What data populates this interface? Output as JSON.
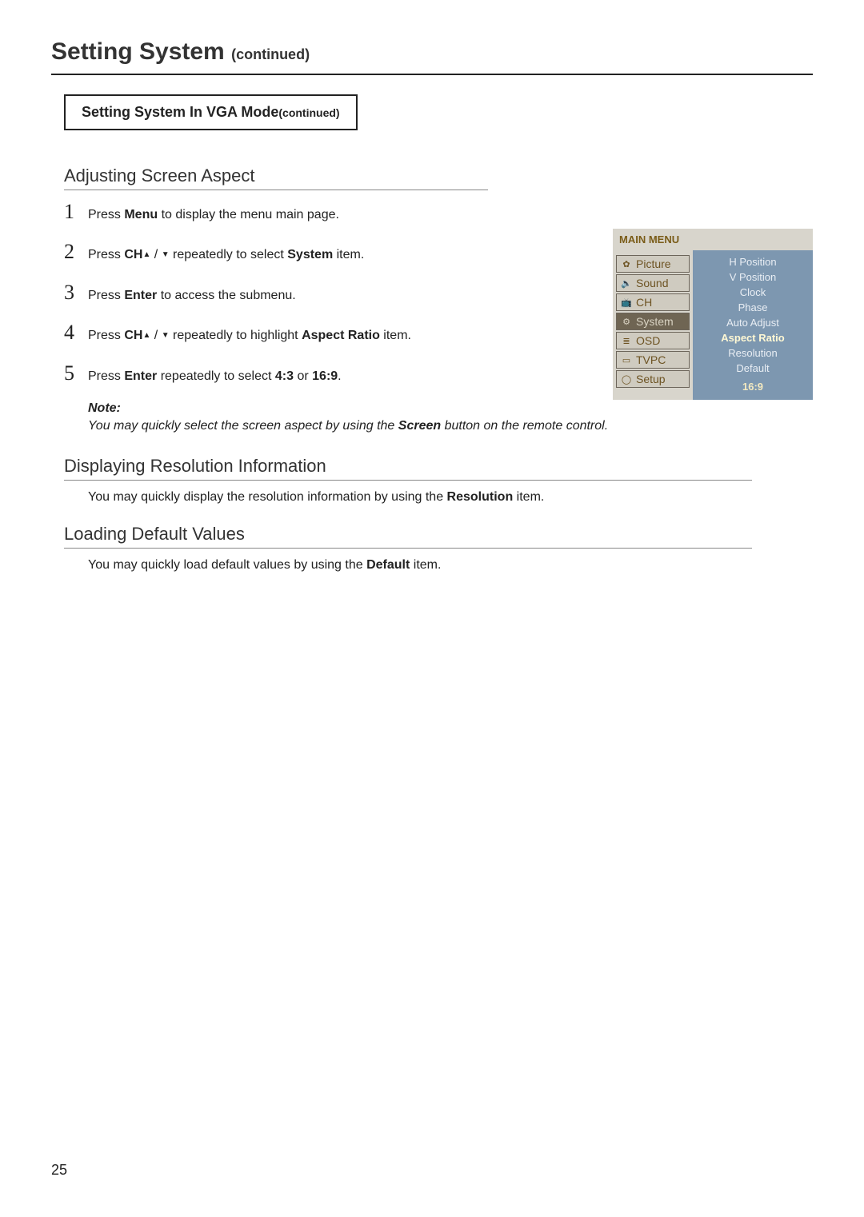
{
  "header": {
    "title": "Setting System",
    "continued": "(continued)"
  },
  "boxTitle": {
    "main": "Setting System In VGA Mode",
    "cont": "(continued)"
  },
  "sections": {
    "aspect": {
      "heading": "Adjusting Screen Aspect",
      "steps": {
        "s1": {
          "num": "1",
          "pre": "Press  ",
          "b1": "Menu",
          "post": " to display the menu main page."
        },
        "s2": {
          "num": "2",
          "pre": "Press ",
          "b1": "CH",
          "arr1": "▲",
          "sep": " / ",
          "arr2": "▼",
          "mid": "  repeatedly to select ",
          "b2": "System",
          "post": " item."
        },
        "s3": {
          "num": "3",
          "pre": "Press ",
          "b1": "Enter",
          "post": " to access the submenu."
        },
        "s4": {
          "num": "4",
          "pre": "Press ",
          "b1": "CH",
          "arr1": "▲",
          "sep": " / ",
          "arr2": "▼",
          "mid": "  repeatedly to highlight ",
          "b2": "Aspect Ratio",
          "post": " item."
        },
        "s5": {
          "num": "5",
          "pre": "Press ",
          "b1": "Enter",
          "mid": " repeatedly to select ",
          "b2": "4:3",
          "or": " or ",
          "b3": "16:9",
          "post": "."
        }
      },
      "note": {
        "head": "Note:",
        "body_pre": "You may quickly select the screen aspect by using the ",
        "body_b": "Screen",
        "body_post": " button on the remote control."
      }
    },
    "resolution": {
      "heading": "Displaying Resolution Information",
      "para_pre": "You may quickly display the resolution information by using the ",
      "para_b": "Resolution",
      "para_post": " item."
    },
    "defaults": {
      "heading": "Loading Default Values",
      "para_pre": "You may quickly load default values  by using the ",
      "para_b": "Default",
      "para_post": " item."
    }
  },
  "osd": {
    "title": "MAIN MENU",
    "left": [
      {
        "label": "Picture",
        "highlight": false,
        "icon": "✿"
      },
      {
        "label": "Sound",
        "highlight": false,
        "icon": "🔈"
      },
      {
        "label": "CH",
        "highlight": false,
        "icon": "📺"
      },
      {
        "label": "System",
        "highlight": true,
        "icon": "⚙"
      },
      {
        "label": "OSD",
        "highlight": false,
        "icon": "≣"
      },
      {
        "label": "TVPC",
        "highlight": false,
        "icon": "▭"
      },
      {
        "label": "Setup",
        "highlight": false,
        "icon": "◯"
      }
    ],
    "right": [
      {
        "label": "H Position",
        "sel": false
      },
      {
        "label": "V Position",
        "sel": false
      },
      {
        "label": "Clock",
        "sel": false
      },
      {
        "label": "Phase",
        "sel": false
      },
      {
        "label": "Auto Adjust",
        "sel": false
      },
      {
        "label": "Aspect Ratio",
        "sel": true
      },
      {
        "label": "Resolution",
        "sel": false
      },
      {
        "label": "Default",
        "sel": false
      }
    ],
    "value": "16:9"
  },
  "pageNumber": "25"
}
